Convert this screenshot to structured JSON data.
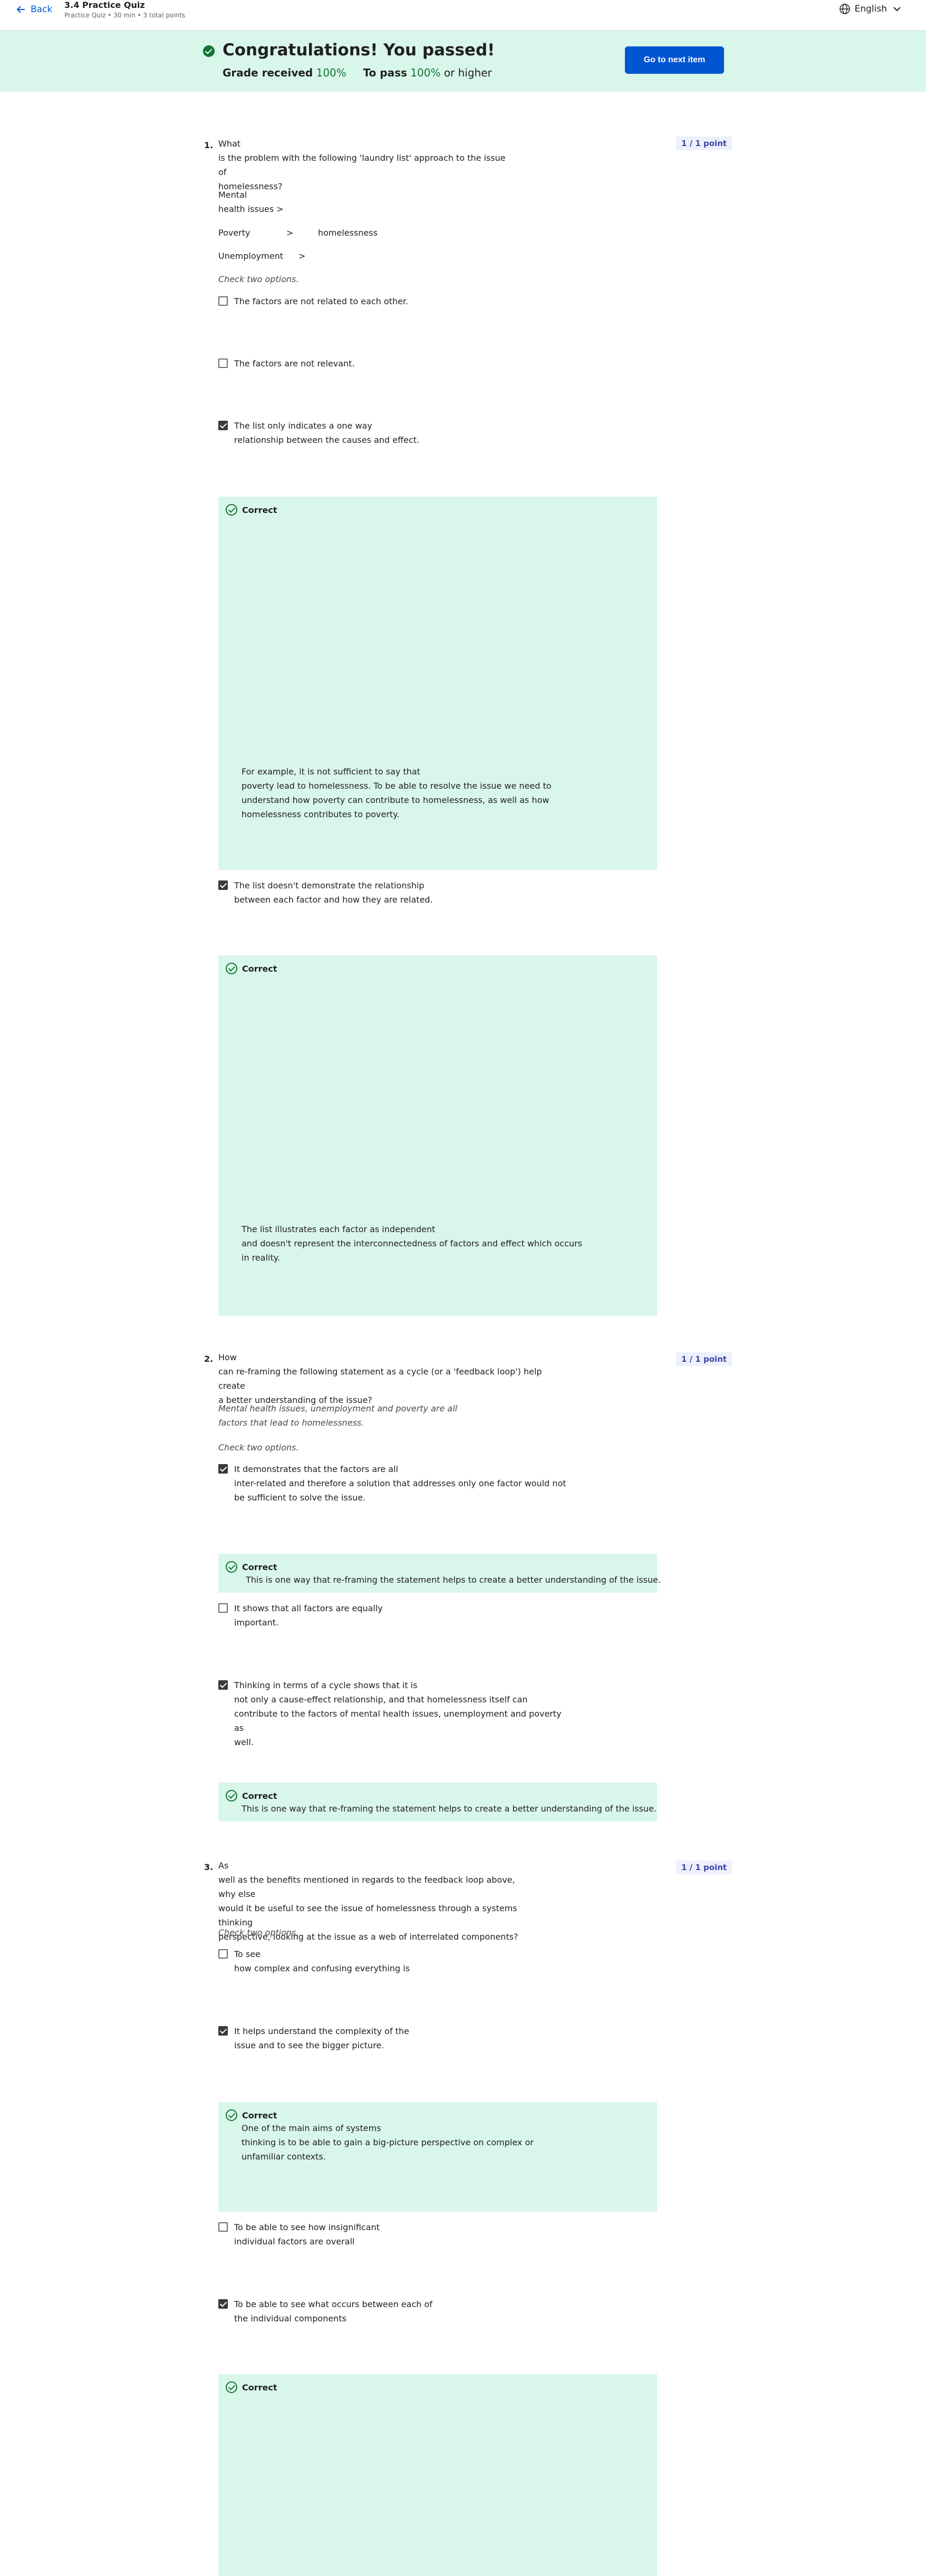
{
  "header": {
    "back_label": "Back",
    "quiz_title": "3.4 Practice Quiz",
    "quiz_meta": "Practice Quiz • 30 min • 3 total points",
    "language": "English"
  },
  "banner": {
    "title": "Congratulations! You passed!",
    "grade_label": "Grade received",
    "grade_value": "100%",
    "pass_label": "To pass",
    "pass_value": "100%",
    "pass_suffix": "or higher",
    "next_button": "Go to next item"
  },
  "questions": [
    {
      "number": "1.",
      "points": "1 / 1 point",
      "text": "What\nis the problem with the following 'laundry list' approach to the issue of\nhomelessness?",
      "list_items": [
        "Mental\nhealth issues  >",
        "Poverty",
        ">",
        "homelessness",
        "Unemployment",
        ">"
      ],
      "instruction": "Check two options.",
      "options": [
        {
          "label": "The factors are not related to each other.",
          "checked": false
        },
        {
          "label": "The factors are not relevant.",
          "checked": false
        },
        {
          "label": "The list only indicates a one way\nrelationship between the causes and effect.",
          "checked": true,
          "feedback_title": "Correct",
          "feedback_text": "For example, it is not sufficient to say that\npoverty lead to homelessness. To be able to resolve the issue we need to\nunderstand how poverty can contribute to homelessness, as well as how\nhomelessness contributes to poverty."
        },
        {
          "label": "The list doesn't demonstrate the relationship\nbetween each factor and how they are related.",
          "checked": true,
          "feedback_title": "Correct",
          "feedback_text": "The list illustrates each factor as independent\nand doesn't represent the interconnectedness of factors and effect which occurs\nin reality."
        }
      ]
    },
    {
      "number": "2.",
      "points": "1 / 1 point",
      "text": "How\ncan re-framing the following statement as a cycle (or a 'feedback loop') help create\na better understanding of the issue?",
      "statement": "Mental health issues, unemployment and poverty are all\nfactors that lead to homelessness.",
      "instruction": "Check two options.",
      "options": [
        {
          "label": "It demonstrates that the factors are all\ninter-related and therefore a solution that addresses only one factor would not\nbe sufficient to solve the issue.",
          "checked": true,
          "feedback_title": "Correct",
          "feedback_text": "This is one way that re-framing the statement helps to create a better understanding of the issue."
        },
        {
          "label": "It shows that all factors are equally\nimportant.",
          "checked": false
        },
        {
          "label": "Thinking in terms of a cycle shows that it is\nnot only a cause-effect relationship, and that homelessness itself can\ncontribute to the factors of mental health issues, unemployment and poverty as\nwell.",
          "checked": true,
          "feedback_title": "Correct",
          "feedback_text": "This is one way that re-framing the statement helps to create a better understanding of the issue."
        }
      ]
    },
    {
      "number": "3.",
      "points": "1 / 1 point",
      "text": "As\nwell as the benefits mentioned in regards to the feedback loop above, why else\nwould it be useful to see the issue of homelessness through a systems thinking\nperspective, looking at the issue as a web of interrelated components?",
      "instruction": "Check two options.",
      "options": [
        {
          "label": "To see\nhow complex and confusing everything is",
          "checked": false
        },
        {
          "label": "It helps understand the complexity of the\nissue and to see the bigger picture.",
          "checked": true,
          "feedback_title": "Correct",
          "feedback_text": "One of the main aims of systems\nthinking is to be able to gain a big-picture perspective on complex or\nunfamiliar contexts."
        },
        {
          "label": "To be able to see how insignificant\nindividual factors are overall",
          "checked": false
        },
        {
          "label": "To be able to see what occurs between each of\nthe individual components",
          "checked": true,
          "feedback_title": "Correct"
        }
      ]
    }
  ]
}
